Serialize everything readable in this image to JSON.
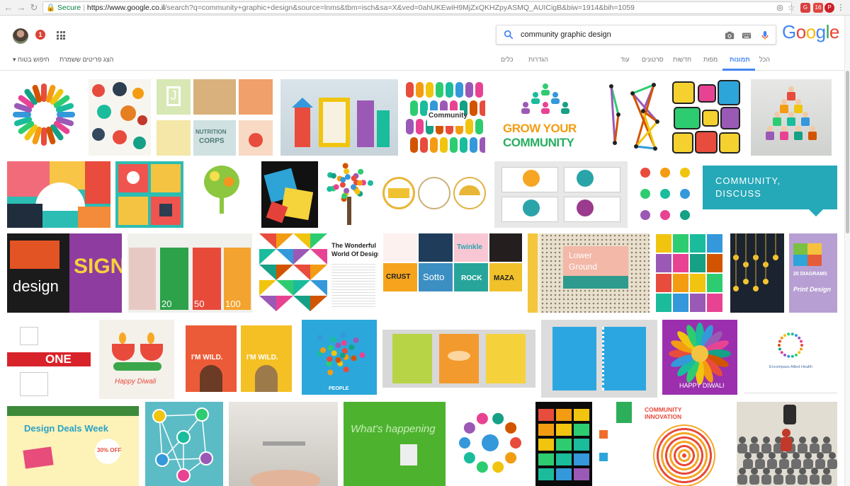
{
  "browser": {
    "secure_label": "Secure",
    "url_host": "https://www.google.co.il",
    "url_rest": "/search?q=community+graphic+design&source=lnms&tbm=isch&sa=X&ved=0ahUKEwiH9MjZxQKHZpyASMQ_AUICigB&biw=1914&bih=1059",
    "ext_badge": "16"
  },
  "header": {
    "notification_count": "1",
    "logo_letters": [
      {
        "ch": "G",
        "color": "#4285f4"
      },
      {
        "ch": "o",
        "color": "#ea4335"
      },
      {
        "ch": "o",
        "color": "#fbbc05"
      },
      {
        "ch": "g",
        "color": "#4285f4"
      },
      {
        "ch": "l",
        "color": "#34a853"
      },
      {
        "ch": "e",
        "color": "#ea4335"
      }
    ]
  },
  "search": {
    "query": "community graphic design"
  },
  "tabs": {
    "all": "הכל",
    "images": "תמונות",
    "maps": "מפות",
    "news": "חדשות",
    "videos": "סרטונים",
    "more": "עוד",
    "settings": "הגדרות",
    "tools": "כלים"
  },
  "left_tools": {
    "show_saved": "הצג פריטים ששמרת",
    "safe_search": "חיפוש בטוח"
  },
  "tiles_text": {
    "community_vector": "Community",
    "grow_your": "GROW YOUR",
    "community_big": "COMMUNITY",
    "community_discuss_1": "COMMUNITY,",
    "community_discuss_2": "DISCUSS",
    "the_wonderful": "The Wonderful",
    "world_of_design": "World Of Design",
    "lower": "Lower",
    "ground": "Ground",
    "twenty_diagrams": "20 DIAGRAMS",
    "print_design": "Print Design",
    "im_wild_1": "I'M WILD.",
    "im_wild_2": "I'M WILD.",
    "happy_diwali_1": "Happy Diwali",
    "happy_diwali_2": "HAPPY DIWALI",
    "one": "ONE",
    "design_deals": "Design Deals Week",
    "thirty_off": "30% OFF",
    "whats_happening": "What's happening",
    "community_innovation": "COMMUNITY INNOVATION",
    "design": "design",
    "sign": "SIGN",
    "twenty": "20",
    "fifty": "50",
    "hundred": "100",
    "crust": "CRUST",
    "sotto": "Sotto",
    "twinkle": "Twinkle",
    "rock": "ROCK",
    "maza": "MAZA",
    "nutrition": "NUTRITION",
    "corps": "CORPS",
    "people": "PEOPLE",
    "encompass": "Encompass Allied Health"
  }
}
